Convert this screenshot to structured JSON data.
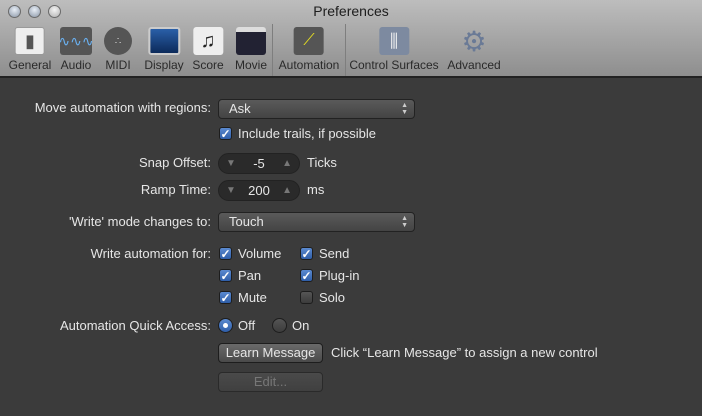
{
  "window": {
    "title": "Preferences"
  },
  "toolbar": [
    {
      "label": "General",
      "icon": "general-switch-icon"
    },
    {
      "label": "Audio",
      "icon": "audio-waveform-icon"
    },
    {
      "label": "MIDI",
      "icon": "midi-connector-icon"
    },
    {
      "label": "Display",
      "icon": "display-monitor-icon"
    },
    {
      "label": "Score",
      "icon": "score-notes-icon"
    },
    {
      "label": "Movie",
      "icon": "movie-clapper-icon"
    },
    {
      "label": "Automation",
      "icon": "automation-curve-icon"
    },
    {
      "label": "Control Surfaces",
      "icon": "control-surfaces-faders-icon"
    },
    {
      "label": "Advanced",
      "icon": "advanced-gear-icon"
    }
  ],
  "move_automation": {
    "label": "Move automation with regions:",
    "value": "Ask"
  },
  "include_trails": {
    "label": "Include trails, if possible",
    "checked": true
  },
  "snap_offset": {
    "label": "Snap Offset:",
    "value": "-5",
    "unit": "Ticks"
  },
  "ramp_time": {
    "label": "Ramp Time:",
    "value": "200",
    "unit": "ms"
  },
  "write_mode": {
    "label": "'Write' mode changes to:",
    "value": "Touch"
  },
  "write_for": {
    "label": "Write automation for:",
    "items": [
      {
        "label": "Volume",
        "checked": true
      },
      {
        "label": "Send",
        "checked": true
      },
      {
        "label": "Pan",
        "checked": true
      },
      {
        "label": "Plug-in",
        "checked": true
      },
      {
        "label": "Mute",
        "checked": true
      },
      {
        "label": "Solo",
        "checked": false
      }
    ]
  },
  "quick_access": {
    "label": "Automation Quick Access:",
    "off": "Off",
    "on": "On",
    "selected": "Off"
  },
  "learn": {
    "button": "Learn Message",
    "hint": "Click “Learn Message” to assign a new control"
  },
  "edit": {
    "button": "Edit..."
  }
}
